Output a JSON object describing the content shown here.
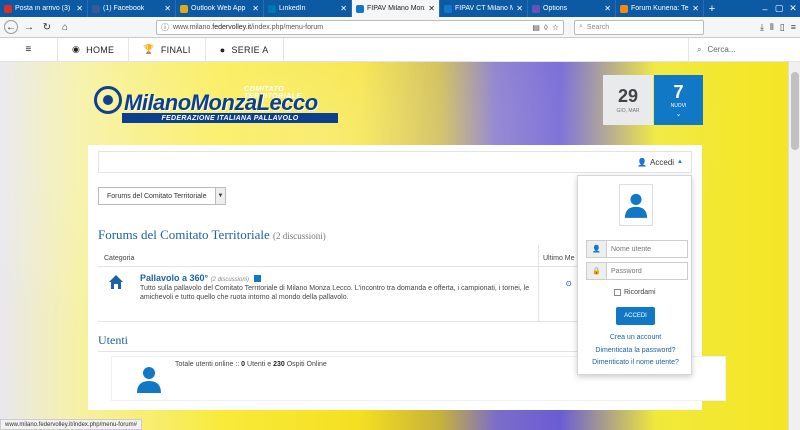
{
  "browser": {
    "tabs": [
      {
        "label": "Posta in arrivo (3)",
        "color": "#d93025"
      },
      {
        "label": "(1) Facebook",
        "color": "#3b5998"
      },
      {
        "label": "Outlook Web App",
        "color": "#e6a817"
      },
      {
        "label": "LinkedIn",
        "color": "#0077b5"
      },
      {
        "label": "FIPAV Milano Monza",
        "color": "#1178c6"
      },
      {
        "label": "FIPAV CT Milano Mo",
        "color": "#1178c6"
      },
      {
        "label": "Options",
        "color": "#6b4fbb"
      },
      {
        "label": "Forum Kunena: Tema",
        "color": "#f58a07"
      }
    ],
    "new_tab": "+",
    "url_prefix": "www.milano.",
    "url_domain": "federvolley.it",
    "url_suffix": "/index.php/menu-forum",
    "search_placeholder": "Search"
  },
  "site_menu": {
    "items": [
      {
        "label": "HOME",
        "icon": "volleyball-icon"
      },
      {
        "label": "FINALI",
        "icon": "trophy-icon"
      },
      {
        "label": "SERIE A",
        "icon": "ball-icon"
      }
    ],
    "search_placeholder": "Cerca..."
  },
  "logo": {
    "comitato": "COMITATO TERRITORIALE",
    "main": "MilanoMonzaLecco",
    "federazione": "FEDERAZIONE ITALIANA PALLAVOLO"
  },
  "date": {
    "day": "29",
    "label": "GIO, MAR"
  },
  "weather": {
    "value": "7",
    "label": "NUOVI"
  },
  "forum": {
    "accedi": "Accedi",
    "select_value": "Forums del Comitato Territoriale",
    "title": "Forums del Comitato Territoriale",
    "count": "(2 discussioni)",
    "col_categoria": "Categoria",
    "col_ultimo": "Ultimo Me",
    "category": {
      "title": "Pallavolo a 360°",
      "count": "(2 discussioni)",
      "description": "Tutto sulla pallavolo del Comitato Territoriale di Milano Monza Lecco. L'incontro tra domanda e offerta, i campionati, i tornei, le amichevoli e tutto quello che ruota intorno al mondo della pallavolo."
    }
  },
  "utenti": {
    "title": "Utenti",
    "online_prefix": "Totale utenti online :: ",
    "online_users": "0",
    "online_mid": " Utenti e ",
    "online_guests": "230",
    "online_suffix": " Ospiti Online"
  },
  "login": {
    "username_placeholder": "Nome utente",
    "password_placeholder": "Password",
    "remember": "Ricordami",
    "button": "ACCEDI",
    "create_account": "Crea un account",
    "forgot_password": "Dimenticata la password?",
    "forgot_username": "Dimenticato il nome utente?"
  },
  "status_url": "www.milano.federvolley.it/index.php/menu-forum#",
  "colors": {
    "brand": "#1178c6",
    "brand_dark": "#0d3f8f",
    "link": "#1d62a5"
  }
}
